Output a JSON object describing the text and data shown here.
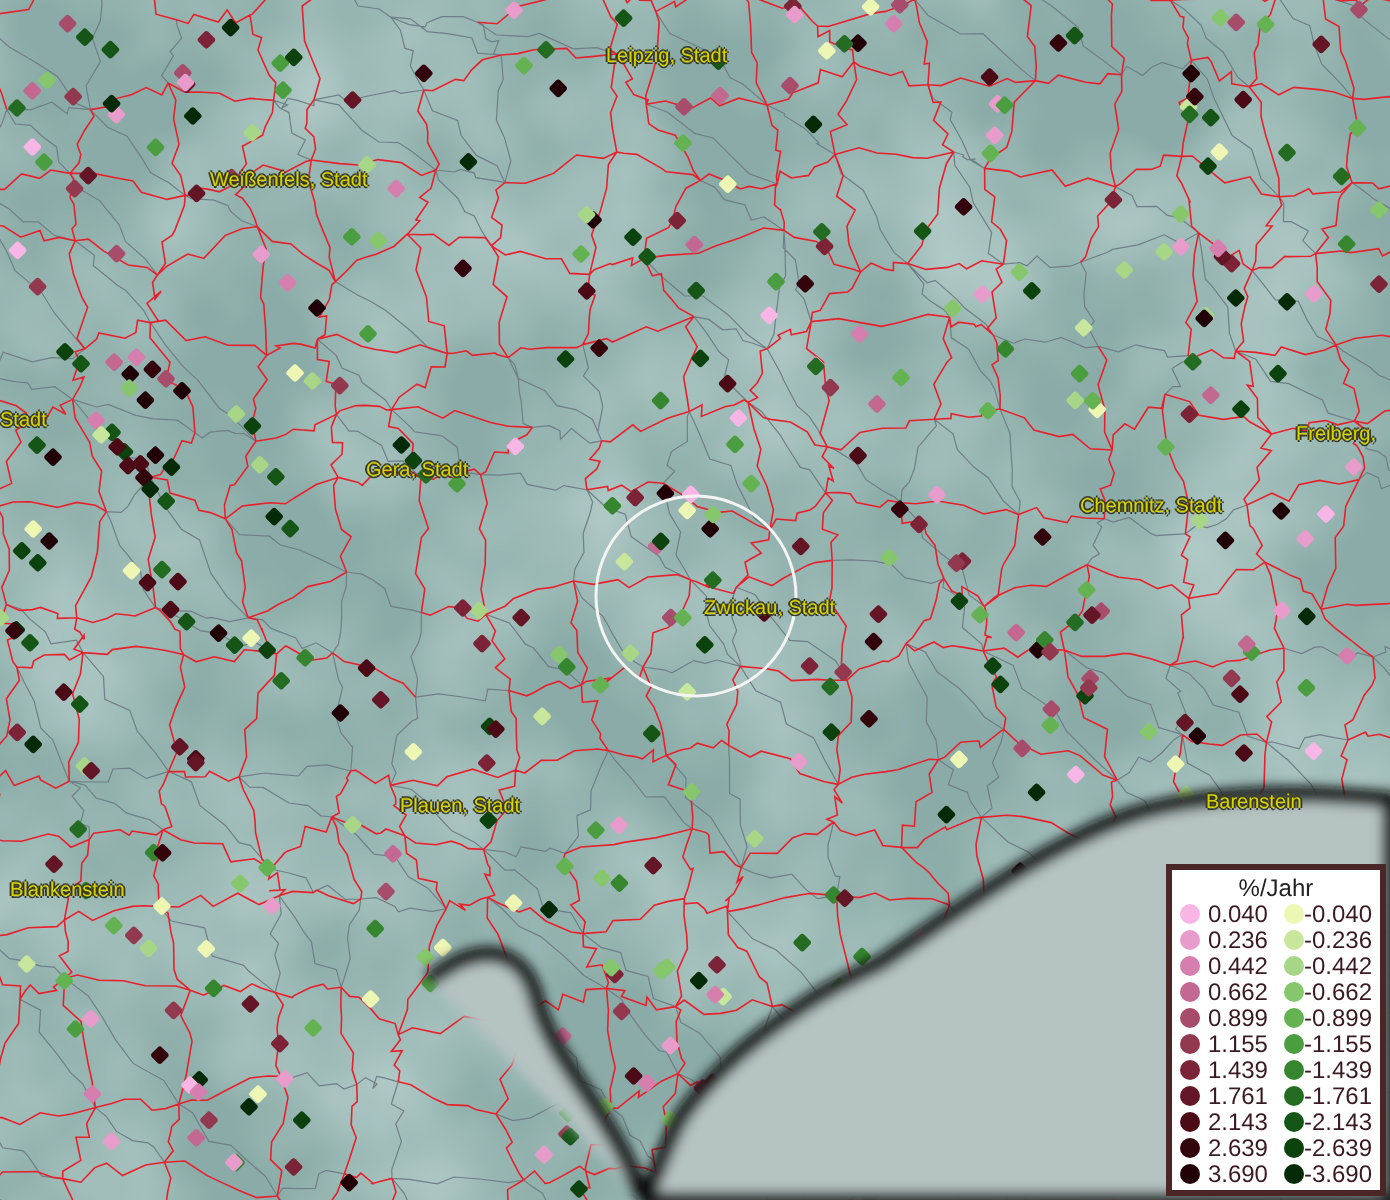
{
  "map": {
    "labels": [
      {
        "text": "Leipzig, Stadt"
      },
      {
        "text": "Weißenfels, Stadt"
      },
      {
        "text": "Stadt"
      },
      {
        "text": "Gera, Stadt"
      },
      {
        "text": "Freiberg,"
      },
      {
        "text": "Chemnitz, Stadt"
      },
      {
        "text": "Zwickau, Stadt"
      },
      {
        "text": "Plauen, Stadt"
      },
      {
        "text": "Barenstein"
      },
      {
        "text": "Blankenstein"
      }
    ]
  },
  "legend": {
    "title": "%/Jahr",
    "rows": [
      {
        "positive": {
          "value": "0.040",
          "color": "#f7b6e6"
        },
        "negative": {
          "value": "-0.040",
          "color": "#eef6b4"
        }
      },
      {
        "positive": {
          "value": "0.236",
          "color": "#e89ccb"
        },
        "negative": {
          "value": "-0.236",
          "color": "#c8e69c"
        }
      },
      {
        "positive": {
          "value": "0.442",
          "color": "#d67fae"
        },
        "negative": {
          "value": "-0.442",
          "color": "#a8d687"
        }
      },
      {
        "positive": {
          "value": "0.662",
          "color": "#c36890"
        },
        "negative": {
          "value": "-0.662",
          "color": "#86c66c"
        }
      },
      {
        "positive": {
          "value": "0.899",
          "color": "#a84c6c"
        },
        "negative": {
          "value": "-0.899",
          "color": "#64b252"
        }
      },
      {
        "positive": {
          "value": "1.155",
          "color": "#93394f"
        },
        "negative": {
          "value": "-1.155",
          "color": "#4b9e3f"
        }
      },
      {
        "positive": {
          "value": "1.439",
          "color": "#7c2338"
        },
        "negative": {
          "value": "-1.439",
          "color": "#35862f"
        }
      },
      {
        "positive": {
          "value": "1.761",
          "color": "#641627"
        },
        "negative": {
          "value": "-1.761",
          "color": "#236c22"
        }
      },
      {
        "positive": {
          "value": "2.143",
          "color": "#4c0a17"
        },
        "negative": {
          "value": "-2.143",
          "color": "#155616"
        }
      },
      {
        "positive": {
          "value": "2.639",
          "color": "#34040d"
        },
        "negative": {
          "value": "-2.639",
          "color": "#0b420e"
        }
      },
      {
        "positive": {
          "value": "3.690",
          "color": "#200006"
        },
        "negative": {
          "value": "-3.690",
          "color": "#052a07"
        }
      }
    ]
  }
}
